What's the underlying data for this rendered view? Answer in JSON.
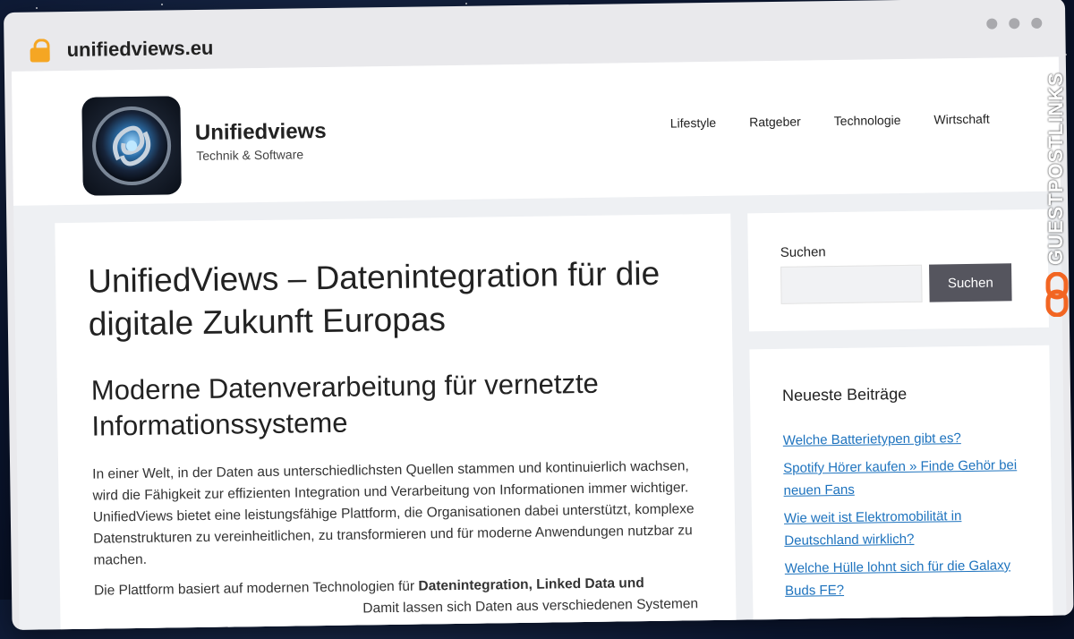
{
  "browser": {
    "url": "unifiedviews.eu"
  },
  "site": {
    "title": "Unifiedviews",
    "tagline": "Technik & Software"
  },
  "nav": {
    "items": [
      {
        "label": "Lifestyle"
      },
      {
        "label": "Ratgeber"
      },
      {
        "label": "Technologie"
      },
      {
        "label": "Wirtschaft"
      }
    ]
  },
  "article": {
    "title": "UnifiedViews – Datenintegration für die digitale Zukunft Europas",
    "subtitle": "Moderne Datenverarbeitung für vernetzte Informationssysteme",
    "paragraph1": "In einer Welt, in der Daten aus unterschiedlichsten Quellen stammen und kontinuierlich wachsen, wird die Fähigkeit zur effizienten Integration und Verarbeitung von Informationen immer wichtiger. UnifiedViews bietet eine leistungsfähige Plattform, die Organisationen dabei unterstützt, komplexe Datenstrukturen zu vereinheitlichen, zu transformieren und für moderne Anwendungen nutzbar zu machen.",
    "paragraph2_prefix": "Die Plattform basiert auf modernen Technologien für ",
    "paragraph2_bold": "Datenintegration, Linked Data und",
    "paragraph2_suffix": "Damit lassen sich Daten aus verschiedenen Systemen"
  },
  "sidebar": {
    "search": {
      "label": "Suchen",
      "button_label": "Suchen",
      "placeholder": ""
    },
    "recent": {
      "title": "Neueste Beiträge",
      "posts": [
        {
          "label": "Welche Batterietypen gibt es?"
        },
        {
          "label": "Spotify Hörer kaufen » Finde Gehör bei neuen Fans"
        },
        {
          "label": "Wie weit ist Elektromobilität in Deutschland wirklich?"
        },
        {
          "label": "Welche Hülle lohnt sich für die Galaxy Buds FE?"
        }
      ]
    }
  },
  "badge": {
    "text": "GUESTPOSTLINKS",
    "accent_color": "#f26522"
  },
  "colors": {
    "link": "#1e73be",
    "button": "#55555e",
    "lock": "#f5a623"
  }
}
